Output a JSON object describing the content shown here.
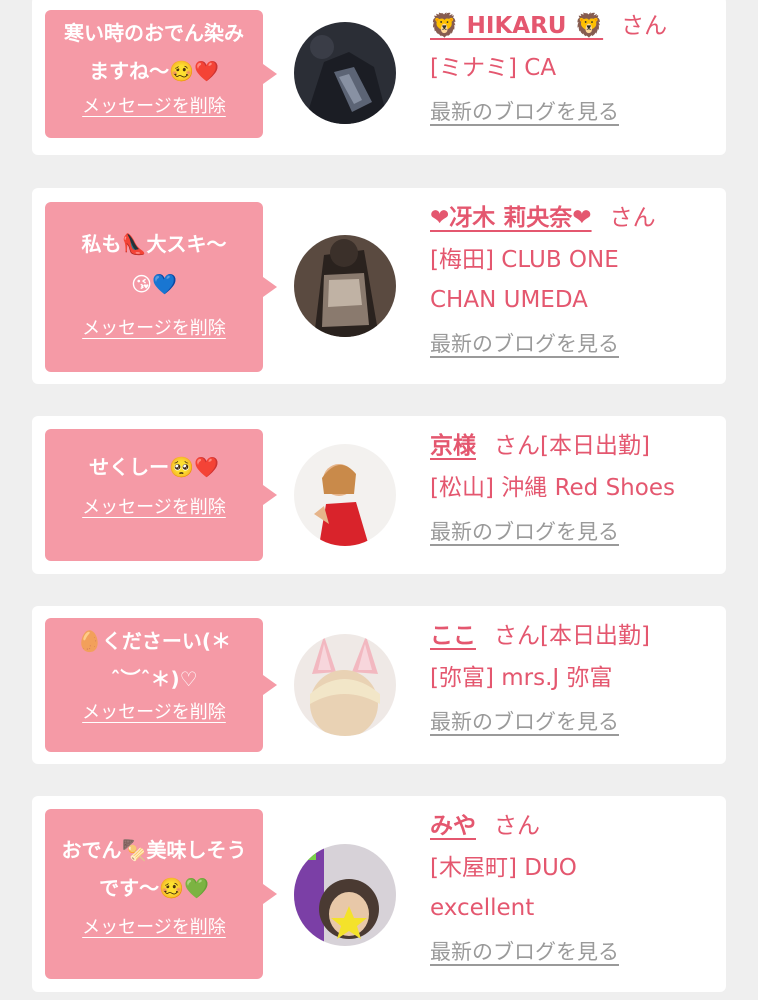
{
  "delete_label": "メッセージを削除",
  "blog_label": "最新のブログを見る",
  "suffix": "さん",
  "colors": {
    "accent": "#e4576f",
    "bubble": "#f59aa6",
    "card": "#ffffff",
    "background": "#efefef",
    "blog_link": "#9a9a9a"
  },
  "cards": [
    {
      "message": "寒い時のおでん染みますね〜🥴❤️",
      "name": "🦁 HIKARU 🦁",
      "status": "",
      "shop_lines": [
        "[ミナミ] CA"
      ],
      "avatar": "dark-jacket-photo"
    },
    {
      "message": "私も👠大スキ〜😘💙",
      "name": "❤冴木 莉央奈❤",
      "status": "",
      "shop_lines": [
        "[梅田] CLUB ONE",
        "CHAN UMEDA"
      ],
      "avatar": "lace-dress-photo"
    },
    {
      "message": "せくしー🥺❤️",
      "name": "京様",
      "status": "[本日出勤]",
      "shop_lines": [
        "[松山] 沖縄 Red Shoes"
      ],
      "avatar": "red-dress-photo"
    },
    {
      "message": "🥚くださーい(＊ ˆ︶ˆ＊)♡",
      "name": "ここ",
      "status": "[本日出勤]",
      "shop_lines": [
        "[弥富] mrs.J 弥富"
      ],
      "avatar": "bunny-ears-photo"
    },
    {
      "message": "おでん🍢美味しそうです〜🥴💚",
      "name": "みや",
      "status": "",
      "shop_lines": [
        "[木屋町] DUO",
        "excellent"
      ],
      "avatar": "star-face-photo"
    }
  ]
}
